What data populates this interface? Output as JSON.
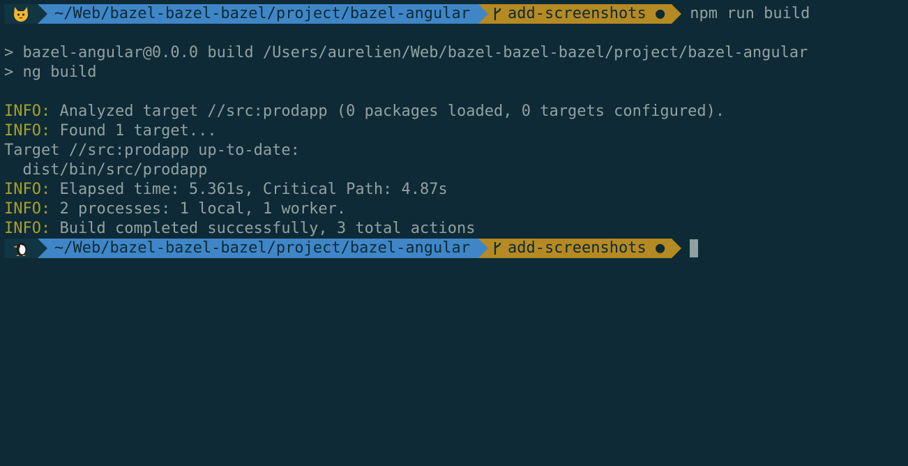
{
  "prompt_top": {
    "path": "~/Web/bazel-bazel-bazel/project/bazel-angular",
    "branch": "add-screenshots ●",
    "command": "npm run build",
    "emoji_icon": "cat-face-icon"
  },
  "output": {
    "pkg_line": "> bazel-angular@0.0.0 build /Users/aurelien/Web/bazel-bazel-bazel/project/bazel-angular",
    "ng_line": "> ng build",
    "info_prefix": "INFO:",
    "info_lines": [
      " Analyzed target //src:prodapp (0 packages loaded, 0 targets configured).",
      " Found 1 target...",
      " Elapsed time: 5.361s, Critical Path: 4.87s",
      " 2 processes: 1 local, 1 worker.",
      " Build completed successfully, 3 total actions"
    ],
    "target_line": "Target //src:prodapp up-to-date:",
    "dist_line": "  dist/bin/src/prodapp"
  },
  "prompt_bottom": {
    "path": "~/Web/bazel-bazel-bazel/project/bazel-angular",
    "branch": "add-screenshots ●",
    "emoji_icon": "penguin-icon"
  },
  "colors": {
    "background": "#0d2a36",
    "text": "#93a1a1",
    "info": "#a8a12a",
    "path_segment": "#3f86c7",
    "branch_segment": "#b58a22"
  }
}
